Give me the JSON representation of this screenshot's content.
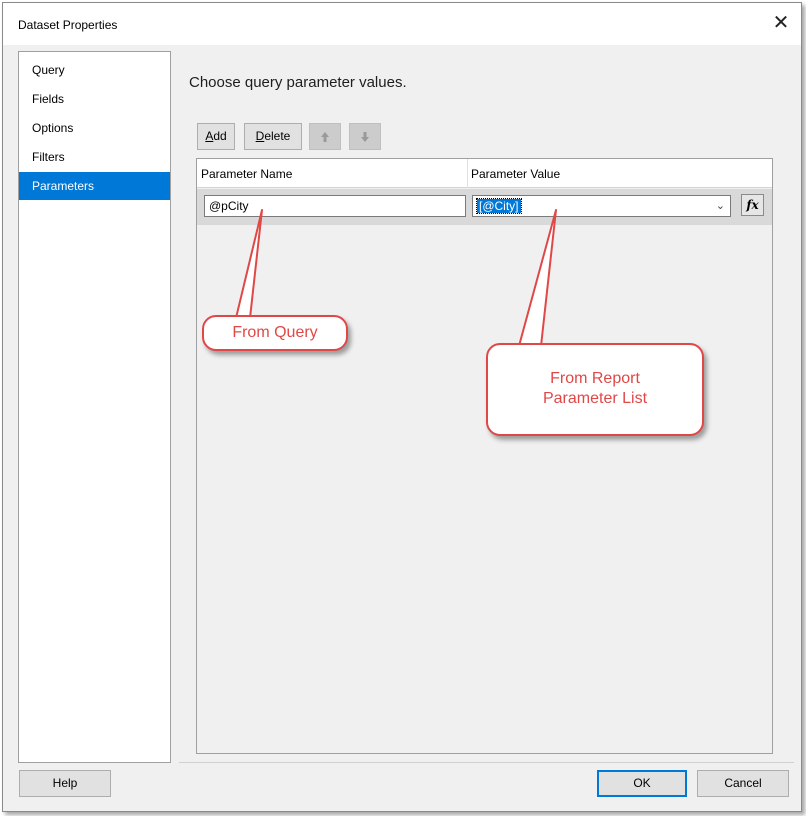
{
  "window": {
    "title": "Dataset Properties",
    "close_glyph": "✕"
  },
  "nav": {
    "items": [
      {
        "label": "Query",
        "selected": false
      },
      {
        "label": "Fields",
        "selected": false
      },
      {
        "label": "Options",
        "selected": false
      },
      {
        "label": "Filters",
        "selected": false
      },
      {
        "label": "Parameters",
        "selected": true
      }
    ]
  },
  "main": {
    "heading": "Choose query parameter values.",
    "toolbar": {
      "add_key": "A",
      "add_rest": "dd",
      "delete_key": "D",
      "delete_rest": "elete",
      "move_up_icon": "arrow-up-icon",
      "move_down_icon": "arrow-down-icon"
    },
    "grid": {
      "columns": [
        "Parameter Name",
        "Parameter Value"
      ],
      "rows": [
        {
          "name": "@pCity",
          "value": "[@City]"
        }
      ],
      "expression_button": "fx"
    }
  },
  "callouts": {
    "from_query": "From Query",
    "from_report_line1": "From Report",
    "from_report_line2": "Parameter List"
  },
  "footer": {
    "help": "Help",
    "ok": "OK",
    "cancel": "Cancel"
  },
  "colors": {
    "selection": "#0078d7",
    "callout": "#e04848"
  }
}
